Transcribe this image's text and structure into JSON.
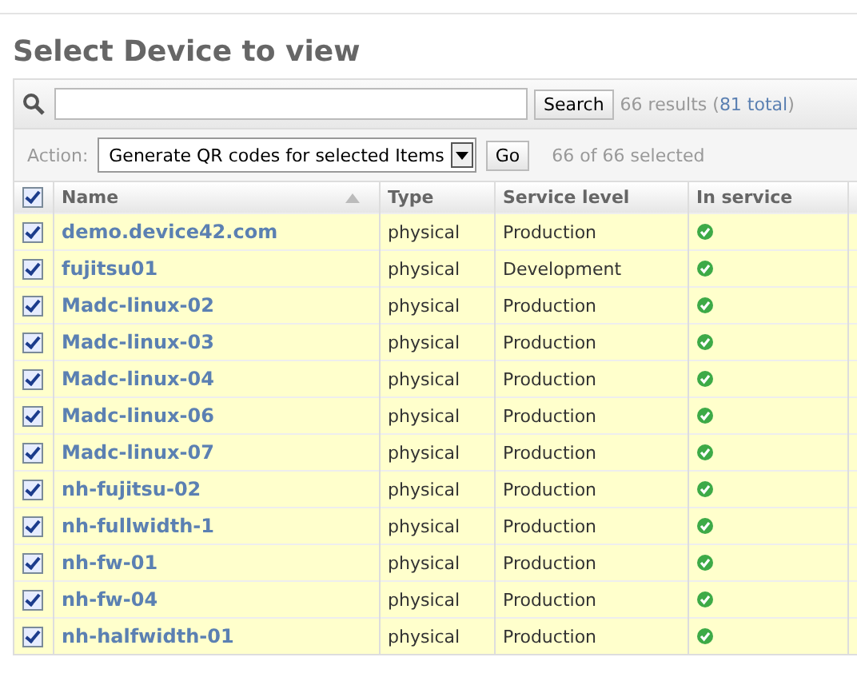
{
  "title": "Select Device to view",
  "search": {
    "button": "Search",
    "results": "66 results (",
    "total_link": "81 total",
    ")": ")"
  },
  "actions": {
    "label": "Action:",
    "selected_action": "Generate QR codes for selected Items",
    "go": "Go",
    "selected_count": "66 of 66 selected"
  },
  "table": {
    "all_checked": true,
    "columns": [
      "Name",
      "Type",
      "Service level",
      "In service"
    ],
    "rows": [
      {
        "name": "demo.device42.com",
        "type": "physical",
        "service_level": "Production",
        "in_service": true,
        "checked": true
      },
      {
        "name": "fujitsu01",
        "type": "physical",
        "service_level": "Development",
        "in_service": true,
        "checked": true
      },
      {
        "name": "Madc-linux-02",
        "type": "physical",
        "service_level": "Production",
        "in_service": true,
        "checked": true
      },
      {
        "name": "Madc-linux-03",
        "type": "physical",
        "service_level": "Production",
        "in_service": true,
        "checked": true
      },
      {
        "name": "Madc-linux-04",
        "type": "physical",
        "service_level": "Production",
        "in_service": true,
        "checked": true
      },
      {
        "name": "Madc-linux-06",
        "type": "physical",
        "service_level": "Production",
        "in_service": true,
        "checked": true
      },
      {
        "name": "Madc-linux-07",
        "type": "physical",
        "service_level": "Production",
        "in_service": true,
        "checked": true
      },
      {
        "name": "nh-fujitsu-02",
        "type": "physical",
        "service_level": "Production",
        "in_service": true,
        "checked": true
      },
      {
        "name": "nh-fullwidth-1",
        "type": "physical",
        "service_level": "Production",
        "in_service": true,
        "checked": true
      },
      {
        "name": "nh-fw-01",
        "type": "physical",
        "service_level": "Production",
        "in_service": true,
        "checked": true
      },
      {
        "name": "nh-fw-04",
        "type": "physical",
        "service_level": "Production",
        "in_service": true,
        "checked": true
      },
      {
        "name": "nh-halfwidth-01",
        "type": "physical",
        "service_level": "Production",
        "in_service": true,
        "checked": true
      }
    ]
  }
}
